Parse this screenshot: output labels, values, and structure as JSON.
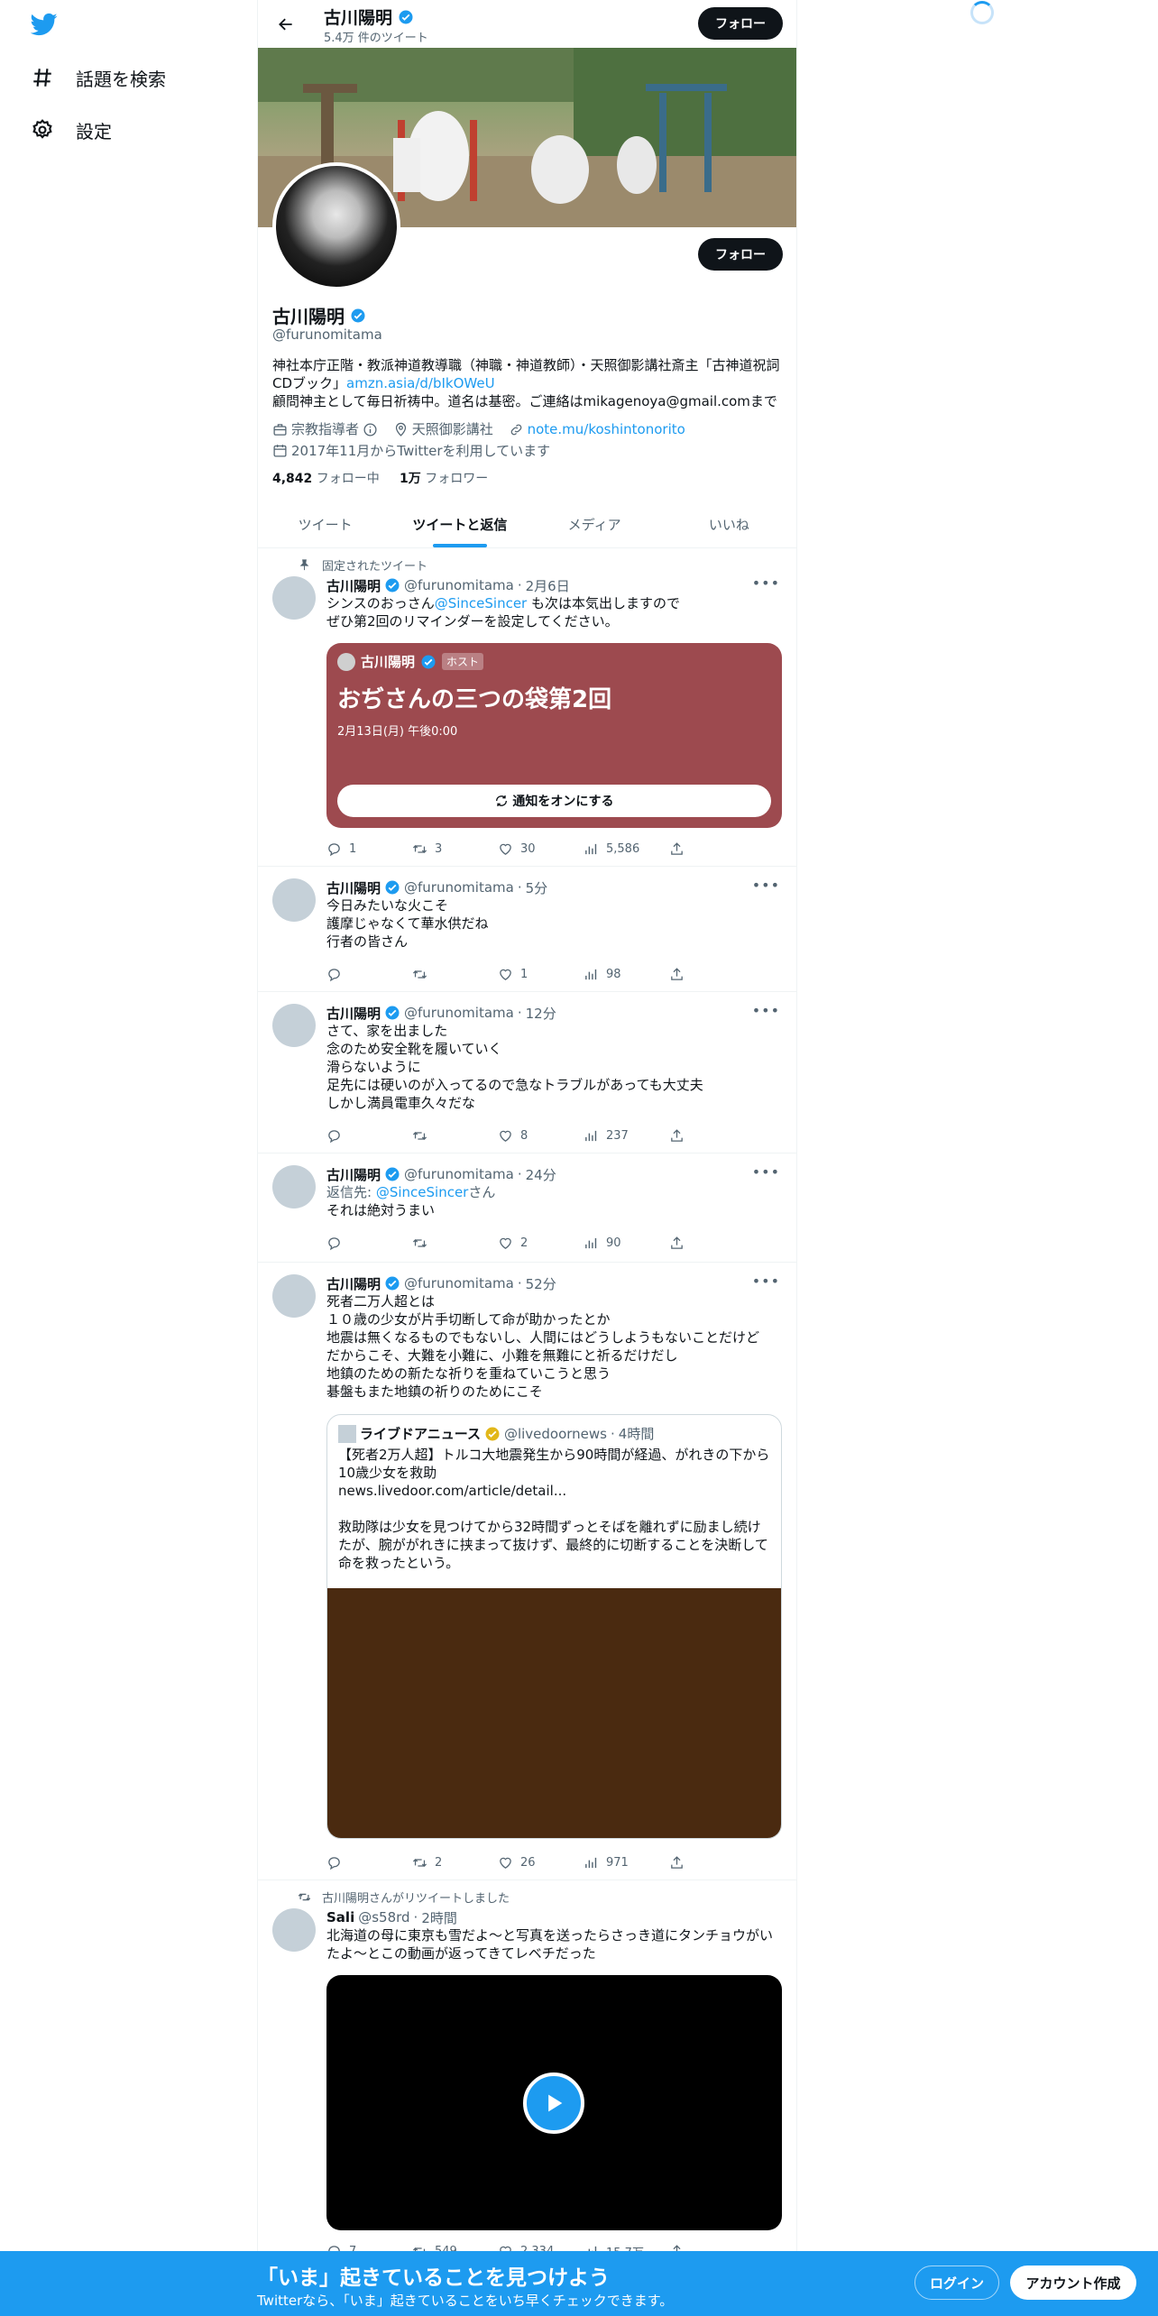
{
  "nav": {
    "explore_label": "話題を検索",
    "settings_label": "設定"
  },
  "header": {
    "name": "古川陽明",
    "tweet_count": "5.4万 件のツイート",
    "follow_label": "フォロー"
  },
  "profile": {
    "name": "古川陽明",
    "handle": "@furunomitama",
    "follow_label": "フォロー",
    "bio_line1": "神社本庁正階・教派神道教導職（神職・神道教師）・天照御影講社斎主「古神道祝詞CDブック」",
    "bio_link": "amzn.asia/d/bIkOWeU",
    "bio_line2": "顧問神主として毎日祈祷中。道名は基密。ご連絡はmikagenoya@gmail.comまで",
    "category": "宗教指導者",
    "location": "天照御影講社",
    "website": "note.mu/koshintonorito",
    "joined": "2017年11月からTwitterを利用しています",
    "following_count": "4,842",
    "following_label": "フォロー中",
    "followers_count": "1万",
    "followers_label": "フォロワー"
  },
  "tabs": [
    {
      "label": "ツイート"
    },
    {
      "label": "ツイートと返信"
    },
    {
      "label": "メディア"
    },
    {
      "label": "いいね"
    }
  ],
  "tweets": [
    {
      "pinned_label": "固定されたツイート",
      "name": "古川陽明",
      "handle": "@furunomitama",
      "time": "2月6日",
      "text_pre": "シンスのおっさん",
      "mention": "@SinceSincer",
      "text_post": " も次は本気出しますので\nぜひ第2回のリマインダーを設定してください。",
      "space": {
        "host_name": "古川陽明",
        "host_badge": "ホスト",
        "title": "おぢさんの三つの袋第2回",
        "date": "2月13日(月) 午後0:00",
        "button": "通知をオンにする"
      },
      "replies": "1",
      "retweets": "3",
      "likes": "30",
      "views": "5,586"
    },
    {
      "name": "古川陽明",
      "handle": "@furunomitama",
      "time": "5分",
      "text": "今日みたいな火こそ\n護摩じゃなくて華水供だね\n行者の皆さん",
      "replies": "",
      "retweets": "",
      "likes": "1",
      "views": "98"
    },
    {
      "name": "古川陽明",
      "handle": "@furunomitama",
      "time": "12分",
      "text": "さて、家を出ました\n念のため安全靴を履いていく\n滑らないように\n足先には硬いのが入ってるので急なトラブルがあっても大丈夫\nしかし満員電車久々だな",
      "replies": "",
      "retweets": "",
      "likes": "8",
      "views": "237"
    },
    {
      "name": "古川陽明",
      "handle": "@furunomitama",
      "time": "24分",
      "reply_prefix": "返信先: ",
      "reply_to": "@SinceSincer",
      "reply_suffix": "さん",
      "text": "それは絶対うまい",
      "replies": "",
      "retweets": "",
      "likes": "2",
      "views": "90"
    },
    {
      "name": "古川陽明",
      "handle": "@furunomitama",
      "time": "52分",
      "text": "死者二万人超とは\n１０歳の少女が片手切断して命が助かったとか\n地震は無くなるものでもないし、人間にはどうしようもないことだけど\nだからこそ、大難を小難に、小難を無難にと祈るだけだし\n地鎮のための新たな祈りを重ねていこうと思う\n碁盤もまた地鎮の祈りのためにこそ",
      "quote": {
        "name": "ライブドアニュース",
        "handle": "@livedoornews",
        "time": "4時間",
        "text": "【死者2万人超】トルコ大地震発生から90時間が経過、がれきの下から10歳少女を救助\nnews.livedoor.com/article/detail...\n\n救助隊は少女を見つけてから32時間ずっとそばを離れずに励まし続けたが、腕ががれきに挟まって抜けず、最終的に切断することを決断して命を救ったという。"
      },
      "replies": "",
      "retweets": "2",
      "likes": "26",
      "views": "971"
    },
    {
      "retweet_label": "古川陽明さんがリツイートしました",
      "name": "Sali",
      "handle": "@s58rd",
      "time": "2時間",
      "text": "北海道の母に東京も雪だよ〜と写真を送ったらさっき道にタンチョウがいたよ〜とこの動画が返ってきてレベチだった",
      "replies": "7",
      "retweets": "549",
      "likes": "2,334",
      "views": "15.7万"
    }
  ],
  "bottom": {
    "title": "「いま」起きていることを見つけよう",
    "subtitle": "Twitterなら、「いま」起きていることをいち早くチェックできます。",
    "login": "ログイン",
    "signup": "アカウント作成"
  },
  "colors": {
    "accent": "#1d9bf0",
    "space_card": "#9d4a4f",
    "text": "#0f1419",
    "secondary": "#536471"
  }
}
